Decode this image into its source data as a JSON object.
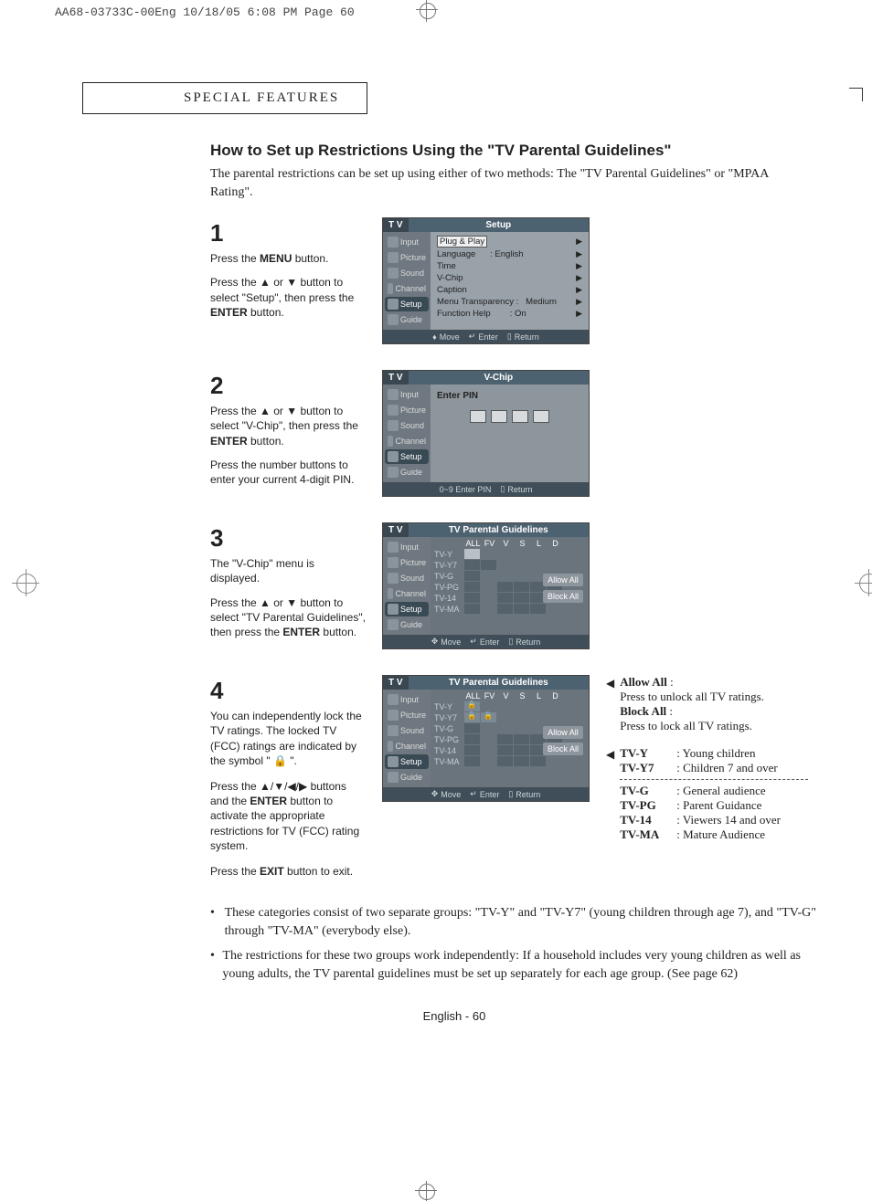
{
  "print_header": "AA68-03733C-00Eng  10/18/05  6:08 PM  Page 60",
  "section_name": "Special Features",
  "title": "How to Set up Restrictions Using the \"TV Parental Guidelines\"",
  "intro": "The parental restrictions can be set up using either of two methods: The \"TV Parental Guidelines\" or \"MPAA Rating\".",
  "steps": {
    "s1": {
      "num": "1",
      "l1a": "Press the ",
      "l1b": "MENU",
      "l1c": " button.",
      "l2a": "Press the ▲ or ▼ button to select \"Setup\", then press the ",
      "l2b": "ENTER",
      "l2c": " button."
    },
    "s2": {
      "num": "2",
      "l1a": "Press the ▲ or ▼ button to select \"V-Chip\", then press the ",
      "l1b": "ENTER",
      "l1c": " button.",
      "l2": "Press the number buttons to enter your current 4-digit PIN."
    },
    "s3": {
      "num": "3",
      "l1": "The \"V-Chip\" menu is displayed.",
      "l2a": "Press the ▲ or ▼ button to select \"TV Parental Guidelines\", then press the ",
      "l2b": "ENTER",
      "l2c": " button."
    },
    "s4": {
      "num": "4",
      "l1": "You can independently lock the TV ratings. The locked TV (FCC) ratings are indicated by the symbol \" 🔒 \".",
      "l2a": "Press the ▲/▼/◀/▶ buttons and the ",
      "l2b": "ENTER",
      "l2c": " button to activate the appropriate restrictions for TV (FCC) rating system.",
      "l3a": "Press the ",
      "l3b": "EXIT",
      "l3c": " button to exit."
    }
  },
  "osd": {
    "tv": "T V",
    "side": {
      "input": "Input",
      "picture": "Picture",
      "sound": "Sound",
      "channel": "Channel",
      "setup": "Setup",
      "guide": "Guide"
    },
    "setup": {
      "title": "Setup",
      "r1": "Plug & Play",
      "r2l": "Language",
      "r2r": ": English",
      "r3": "Time",
      "r4": "V-Chip",
      "r5": "Caption",
      "r6l": "Menu Transparency :",
      "r6r": "Medium",
      "r7l": "Function Help",
      "r7r": ": On"
    },
    "vchip": {
      "title": "V-Chip",
      "enter_pin": "Enter PIN"
    },
    "tvpg": {
      "title": "TV Parental Guidelines",
      "cols": {
        "all": "ALL",
        "fv": "FV",
        "v": "V",
        "s": "S",
        "l": "L",
        "d": "D"
      },
      "rows": {
        "y": "TV-Y",
        "y7": "TV-Y7",
        "g": "TV-G",
        "pg": "TV-PG",
        "14": "TV-14",
        "ma": "TV-MA"
      },
      "allow": "Allow All",
      "block": "Block All"
    },
    "foot": {
      "move": "Move",
      "enter": "Enter",
      "return": "Return",
      "pin": "0~9  Enter PIN"
    }
  },
  "side_notes": {
    "allow_lbl": "Allow All",
    "allow_txt": "Press to unlock all TV ratings.",
    "block_lbl": "Block All",
    "block_txt": "Press to lock all TV ratings.",
    "ratings": {
      "y": {
        "c": "TV-Y",
        "d": ": Young children"
      },
      "y7": {
        "c": "TV-Y7",
        "d": ": Children 7 and over"
      },
      "g": {
        "c": "TV-G",
        "d": ": General audience"
      },
      "pg": {
        "c": "TV-PG",
        "d": ": Parent Guidance"
      },
      "r14": {
        "c": "TV-14",
        "d": ": Viewers 14 and over"
      },
      "ma": {
        "c": "TV-MA",
        "d": ": Mature Audience"
      }
    }
  },
  "bullets": {
    "b1": "These categories consist of two separate groups: \"TV-Y\" and \"TV-Y7\" (young children through age 7), and \"TV-G\" through \"TV-MA\" (everybody else).",
    "b2": "The restrictions for these two groups work independently: If a household includes very young children as well as young adults, the TV parental guidelines must be set up separately for each age group. (See page 62)"
  },
  "footer": {
    "lang": "English",
    "sep": "-",
    "page": "60"
  }
}
